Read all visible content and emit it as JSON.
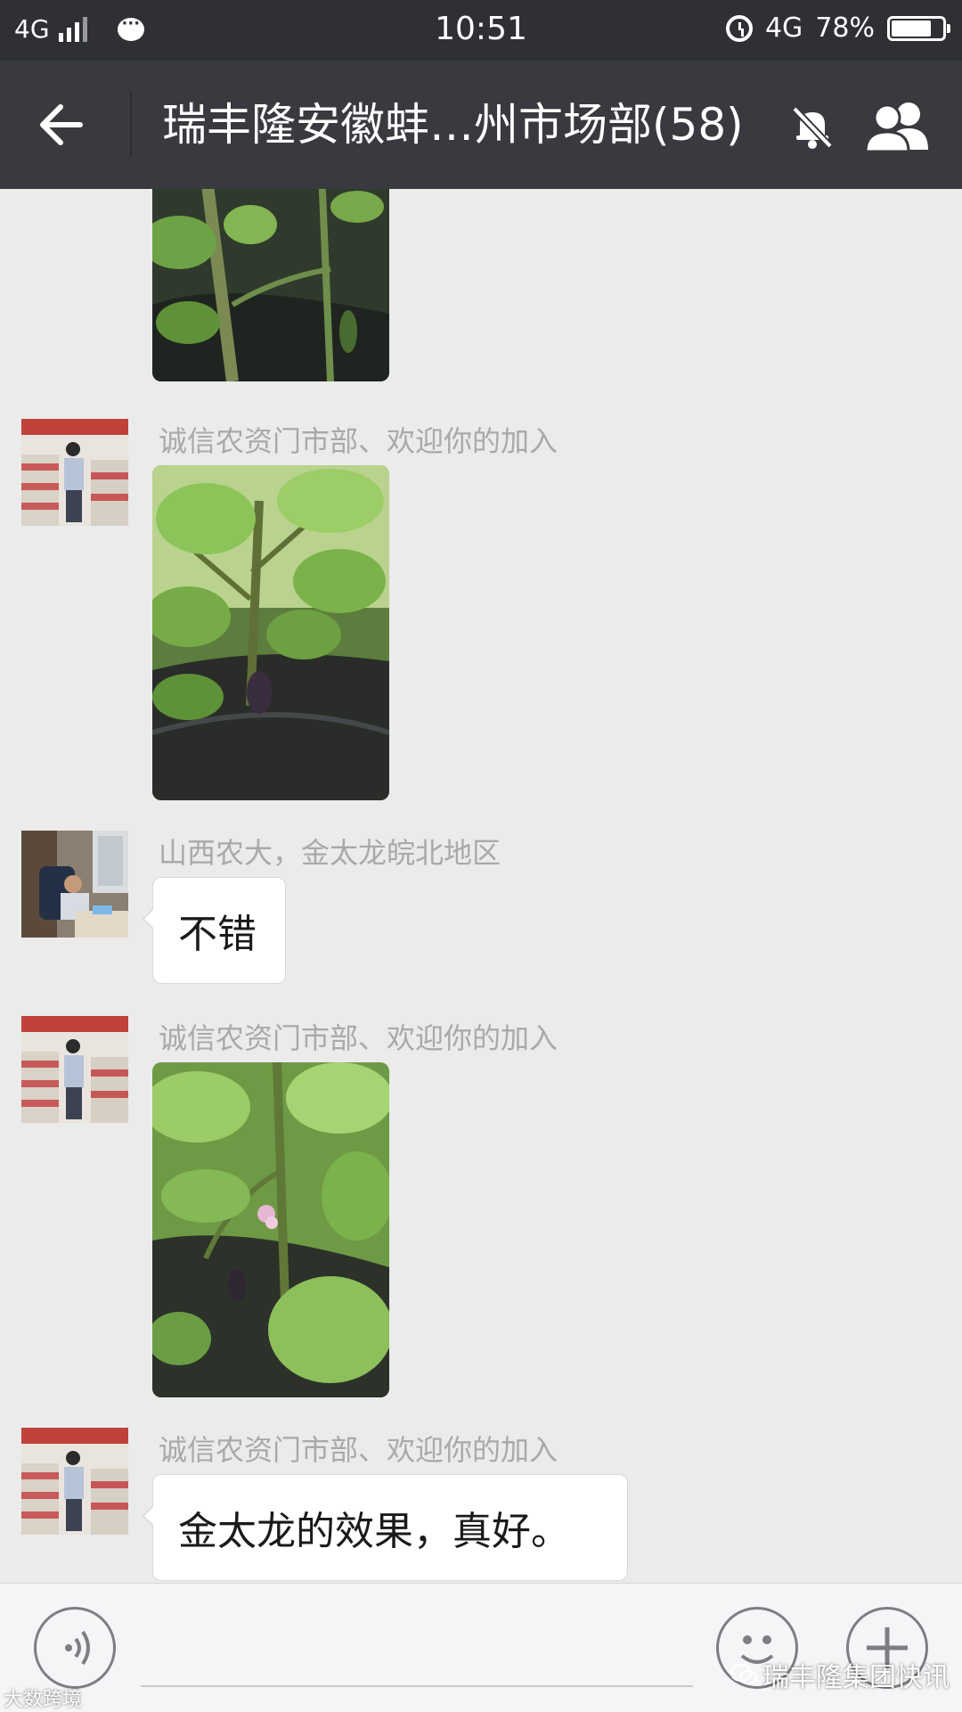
{
  "status_bar": {
    "network": "4G",
    "time": "10:51",
    "network_right": "4G",
    "battery": "78%",
    "battery_level": 0.78
  },
  "header": {
    "title": "瑞丰隆安徽蚌…州市场部(58)"
  },
  "messages": [
    {
      "type": "image",
      "subject": "eggplant plant photo (partially scrolled)"
    },
    {
      "type": "image",
      "sender": "诚信农资门市部、欢迎你的加入",
      "subject": "eggplant plant photo"
    },
    {
      "type": "text",
      "sender": "山西农大，金太龙皖北地区",
      "text": "不错"
    },
    {
      "type": "image",
      "sender": "诚信农资门市部、欢迎你的加入",
      "subject": "eggplant flower photo"
    },
    {
      "type": "text",
      "sender": "诚信农资门市部、欢迎你的加入",
      "text": "金太龙的效果，真好。"
    }
  ],
  "watermark": {
    "account": "瑞丰隆集团快讯",
    "corner": "大数跨境"
  },
  "colors": {
    "title_bar": "#393a3f",
    "status_bar": "#2e3036",
    "chat_background": "#ebebeb",
    "bubble": "#ffffff",
    "sender_text": "#a9a9a9"
  },
  "icons": [
    "back-arrow-icon",
    "mute-bell-icon",
    "group-members-icon",
    "voice-icon",
    "emoji-icon",
    "plus-icon"
  ]
}
